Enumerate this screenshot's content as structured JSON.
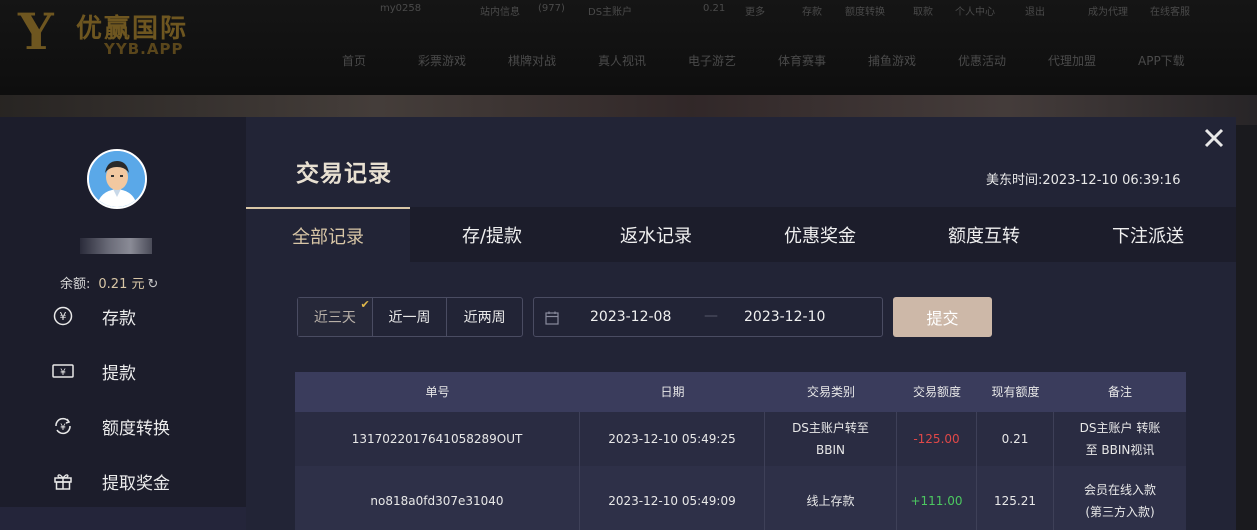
{
  "background": {
    "logo": {
      "brand": "优赢国际",
      "sub": "YYB.APP"
    },
    "topbar": [
      "my0258",
      "站内信息",
      "(977)",
      "DS主账户",
      "0.21",
      "更多",
      "存款",
      "额度转换",
      "取款",
      "个人中心",
      "退出",
      "成为代理",
      "在线客服"
    ],
    "nav": [
      "首页",
      "彩票游戏",
      "棋牌对战",
      "真人视讯",
      "电子游艺",
      "体育赛事",
      "捕鱼游戏",
      "优惠活动",
      "代理加盟",
      "APP下载"
    ]
  },
  "sidebar": {
    "balance_label": "余额:",
    "balance_value": "0.21 元",
    "refresh_icon": "↻",
    "items": [
      {
        "label": "存款",
        "icon": "deposit-icon"
      },
      {
        "label": "提款",
        "icon": "withdraw-icon"
      },
      {
        "label": "额度转换",
        "icon": "transfer-icon"
      },
      {
        "label": "提取奖金",
        "icon": "gift-icon"
      }
    ]
  },
  "main": {
    "title": "交易记录",
    "server_time_label": "美东时间:",
    "server_time": "2023-12-10 06:39:16",
    "close_icon": "×",
    "tabs": [
      "全部记录",
      "存/提款",
      "返水记录",
      "优惠奖金",
      "额度互转",
      "下注派送"
    ],
    "range_buttons": [
      "近三天",
      "近一周",
      "近两周"
    ],
    "date_start": "2023-12-08",
    "date_sep": "—",
    "date_end": "2023-12-10",
    "submit_label": "提交",
    "table": {
      "headers": [
        "单号",
        "日期",
        "交易类别",
        "交易额度",
        "现有额度",
        "备注"
      ],
      "rows": [
        [
          "131702201764105828​9OUT",
          "2023-12-10 05:49:25",
          "DS主账户转至BBIN",
          "-125.00",
          "0.21",
          "DS主账户 转账至 BBIN视讯"
        ],
        [
          "no818a0fd307e31040",
          "2023-12-10 05:49:09",
          "线上存款",
          "+111.00",
          "125.21",
          "会员在线入款(第三方入款)"
        ]
      ]
    }
  },
  "colors": {
    "accent": "#d8c6a6",
    "submit": "#cdb8a8",
    "negative": "#e04848",
    "positive": "#4cc860"
  }
}
